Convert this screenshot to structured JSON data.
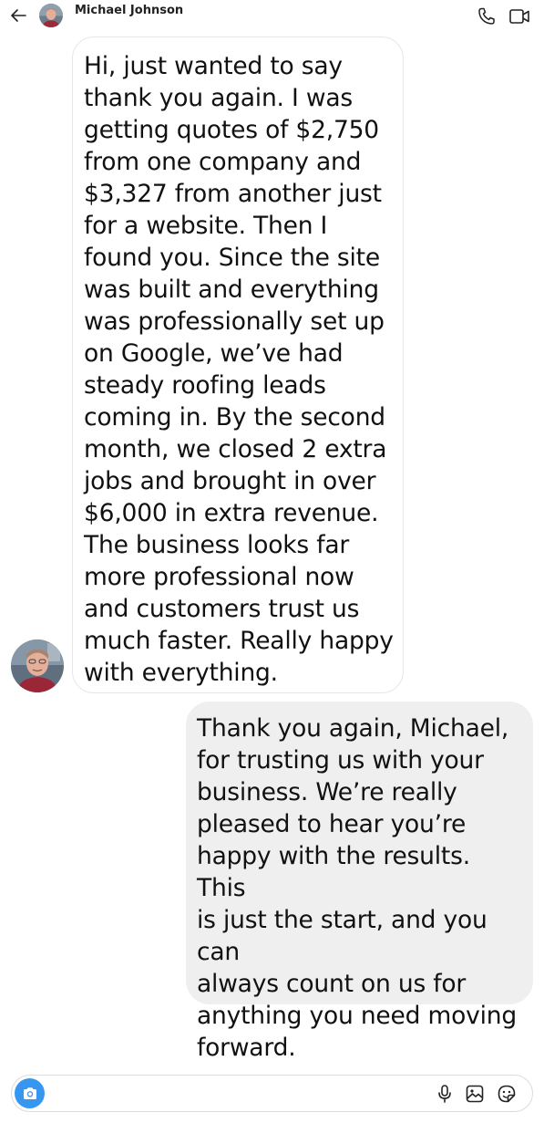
{
  "header": {
    "contact_name": "Michael Johnson",
    "icons": {
      "back": "arrow-left-icon",
      "call": "phone-icon",
      "video": "video-camera-icon"
    }
  },
  "messages": [
    {
      "direction": "incoming",
      "text": "Hi, just wanted to say\nthank you again. I was\ngetting quotes of $2,750\nfrom one company and\n$3,327 from another just\nfor a website. Then I\nfound you. Since the site\nwas built and everything\nwas professionally set up\non Google, we’ve had\nsteady roofing leads\ncoming in. By the second\nmonth, we closed 2 extra\njobs and brought in over\n$6,000 in extra revenue.\nThe business looks far\nmore professional now\nand customers trust us\nmuch faster. Really happy\nwith everything."
    },
    {
      "direction": "outgoing",
      "text": "Thank you again, Michael,\nfor trusting us with your\nbusiness. We’re really\npleased to hear you’re\nhappy with the results. This\nis just the start, and you can\nalways count on us for\nanything you need moving\nforward."
    }
  ],
  "composer": {
    "value": "",
    "icons": {
      "camera": "camera-icon",
      "mic": "microphone-icon",
      "gallery": "image-icon",
      "sticker": "sticker-icon"
    }
  },
  "colors": {
    "accent": "#3797f0",
    "outgoing_bubble": "#efefef",
    "incoming_border": "#e6e6e6"
  }
}
